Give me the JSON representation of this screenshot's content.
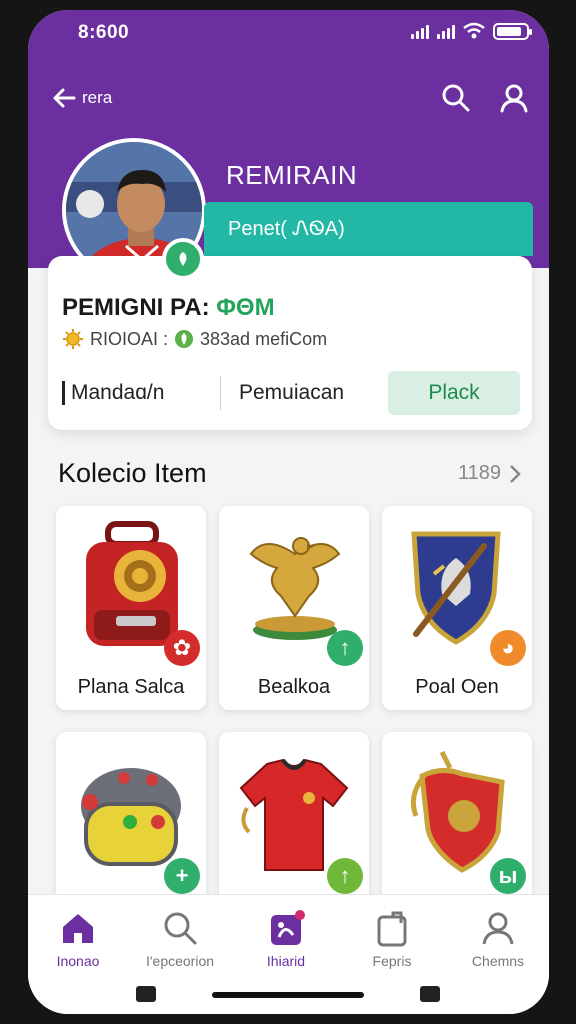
{
  "status": {
    "time": "8:600"
  },
  "topbar": {
    "back_label": "rera"
  },
  "profile": {
    "name": "REMIRAIN",
    "subtitle": "Penet( ᏁᏫA)",
    "card_title": "PEMIGNI PA:",
    "card_title_highlight": "ΦΘΜ",
    "meta_left": "RIOIOAI :",
    "meta_right": "383ad mefiCom",
    "tab1": "Mandaɑ/n",
    "tab2": "Pemuiacan",
    "play_label": "Plack"
  },
  "collection": {
    "title": "Kolecio Item",
    "count": "1189",
    "items": [
      {
        "label": "Plana Salca",
        "icon": "backpack-icon",
        "badge": "✿",
        "badge_color": "#d42b2b"
      },
      {
        "label": "Bealkoa",
        "icon": "eagle-statue-icon",
        "badge": "↑",
        "badge_color": "#2fae6c"
      },
      {
        "label": "Poal Oen",
        "icon": "shield-icon",
        "badge": "◕",
        "badge_color": "#f08a2a"
      },
      {
        "label": "",
        "icon": "robot-helmet-icon",
        "badge": "+",
        "badge_color": "#2fae6c"
      },
      {
        "label": "",
        "icon": "jersey-icon",
        "badge": "↑",
        "badge_color": "#6fb83a"
      },
      {
        "label": "",
        "icon": "badge-shield-icon",
        "badge": "ы",
        "badge_color": "#2fae6c"
      }
    ]
  },
  "nav": [
    {
      "label": "Inonao",
      "icon": "home-icon",
      "active": true
    },
    {
      "label": "I'epceorion",
      "icon": "search-icon",
      "active": false
    },
    {
      "label": "Ihiarid",
      "icon": "inventory-icon",
      "active": true
    },
    {
      "label": "Fepris",
      "icon": "bag-icon",
      "active": false
    },
    {
      "label": "Chemns",
      "icon": "user-icon",
      "active": false
    }
  ],
  "colors": {
    "primary": "#6b2fa0",
    "teal": "#22b8a5",
    "green": "#23a35b"
  }
}
